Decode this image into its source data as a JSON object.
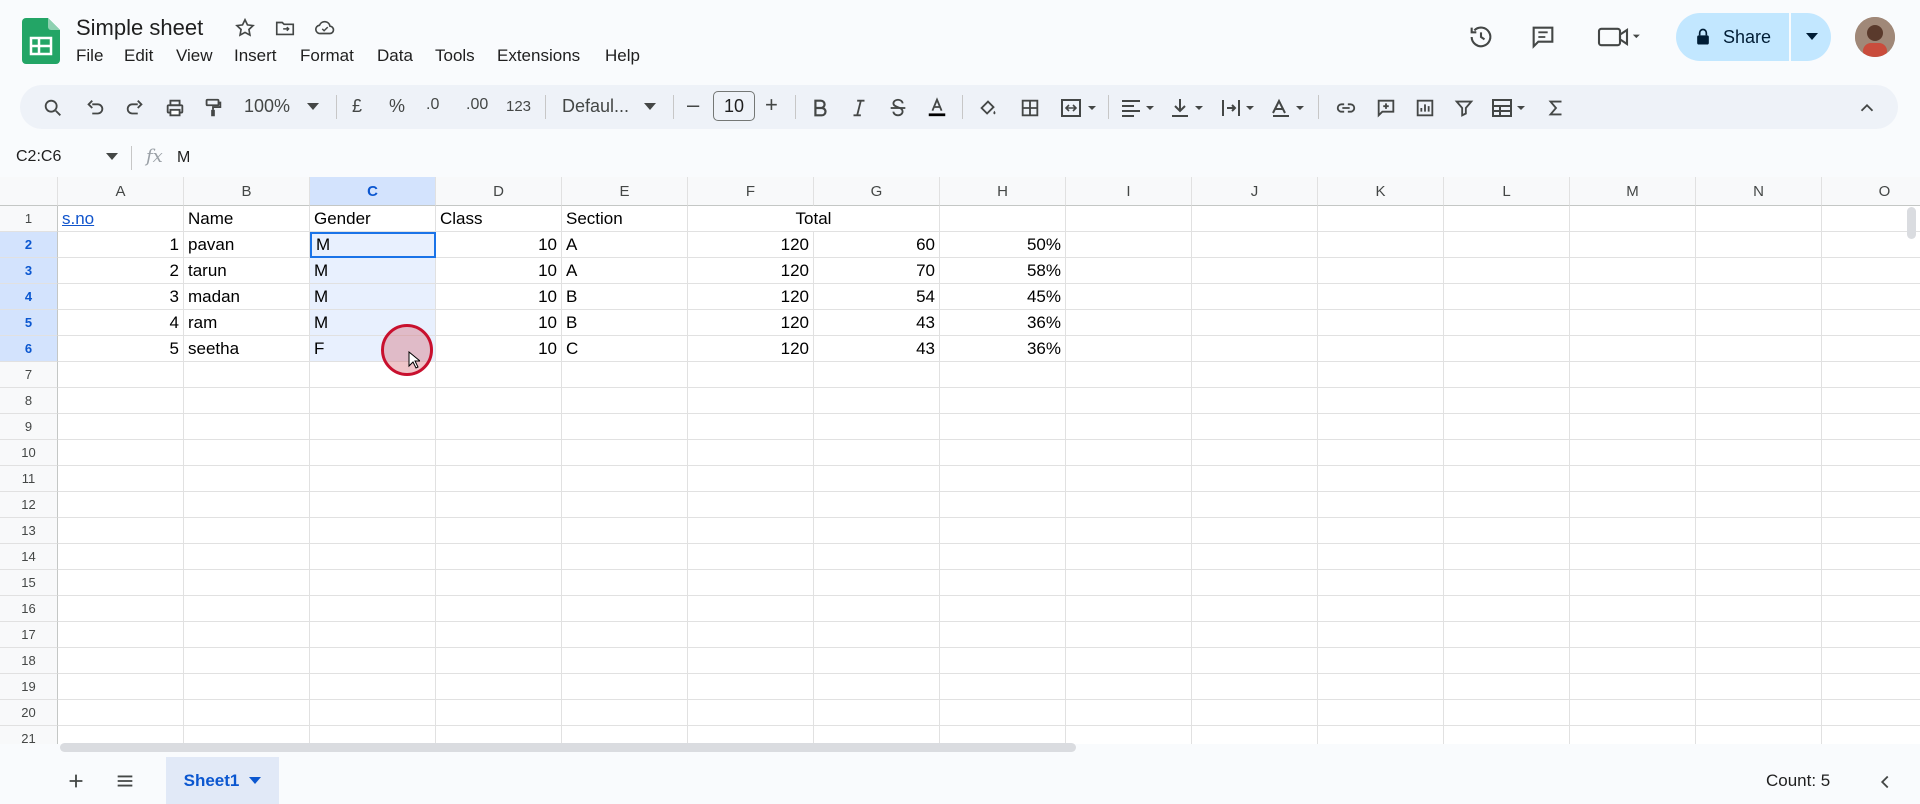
{
  "app": {
    "title": "Simple sheet",
    "menu": [
      "File",
      "Edit",
      "View",
      "Insert",
      "Format",
      "Data",
      "Tools",
      "Extensions",
      "Help"
    ],
    "share_label": "Share"
  },
  "toolbar": {
    "zoom": "100%",
    "currency": "£",
    "percent": "%",
    "dec_decrease": ".0",
    "dec_increase": ".00",
    "number_format": "123",
    "font": "Defaul...",
    "font_size": "10",
    "minus": "–",
    "plus": "+"
  },
  "formula_bar": {
    "name_box": "C2:C6",
    "fx": "fx",
    "value": "M"
  },
  "columns": [
    "A",
    "B",
    "C",
    "D",
    "E",
    "F",
    "G",
    "H",
    "I",
    "J",
    "K",
    "L",
    "M",
    "N",
    "O"
  ],
  "rows": [
    "1",
    "2",
    "3",
    "4",
    "5",
    "6",
    "7",
    "8",
    "9",
    "10",
    "11",
    "12",
    "13",
    "14",
    "15",
    "16",
    "17",
    "18",
    "19",
    "20",
    "21"
  ],
  "cells": {
    "header": {
      "A": "s.no",
      "B": "Name",
      "C": "Gender",
      "D": "Class",
      "E": "Section",
      "FG": "Total"
    },
    "data": [
      {
        "A": "1",
        "B": "pavan",
        "C": "M",
        "D": "10",
        "E": "A",
        "F": "120",
        "G": "60",
        "H": "50%"
      },
      {
        "A": "2",
        "B": "tarun",
        "C": "M",
        "D": "10",
        "E": "A",
        "F": "120",
        "G": "70",
        "H": "58%"
      },
      {
        "A": "3",
        "B": "madan",
        "C": "M",
        "D": "10",
        "E": "B",
        "F": "120",
        "G": "54",
        "H": "45%"
      },
      {
        "A": "4",
        "B": "ram",
        "C": "M",
        "D": "10",
        "E": "B",
        "F": "120",
        "G": "43",
        "H": "36%"
      },
      {
        "A": "5",
        "B": "seetha",
        "C": "F",
        "D": "10",
        "E": "C",
        "F": "120",
        "G": "43",
        "H": "36%"
      }
    ]
  },
  "bottom": {
    "sheet_tab": "Sheet1",
    "status": "Count: 5"
  },
  "colors": {
    "accent": "#0b57d0",
    "share_bg": "#c2e7ff",
    "selection": "#e8f0fe"
  }
}
